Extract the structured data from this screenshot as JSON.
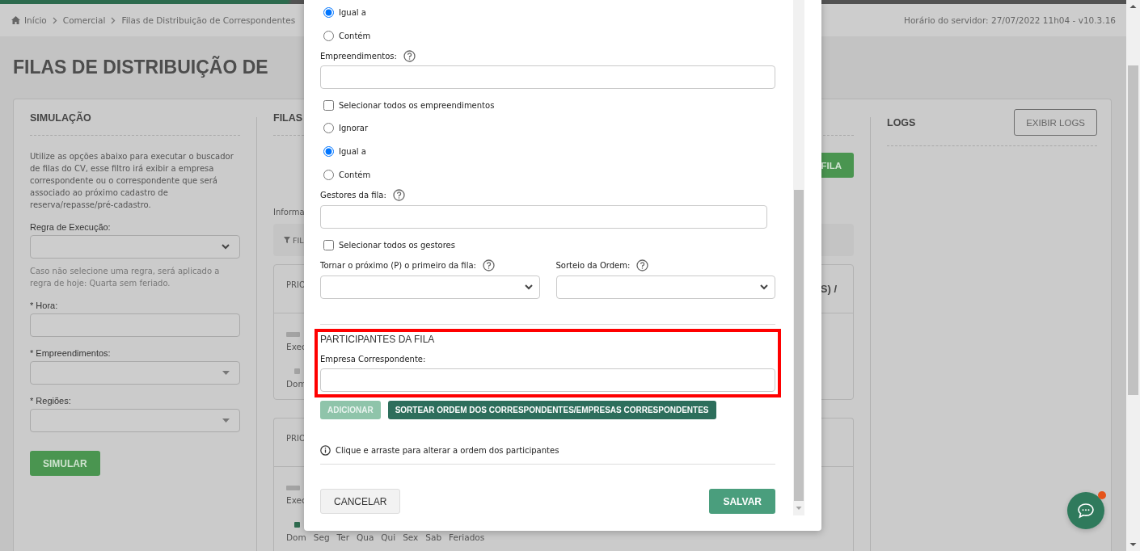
{
  "breadcrumb": [
    {
      "label": "Início",
      "kind": "home"
    },
    {
      "label": "Comercial",
      "kind": "link"
    },
    {
      "label": "Filas de Distribuição de Correspondentes",
      "kind": "link"
    }
  ],
  "server_time": "Horário do servidor: 27/07/2022 11h04 - v10.3.16",
  "page_title": "FILAS DE DISTRIBUIÇÃO DE",
  "simulation": {
    "heading": "SIMULAÇÃO",
    "description": "Utilize as opções abaixo para executar o buscador de filas do CV, esse filtro irá exibir a empresa correspondente ou o correspondente que será associado ao próximo cadastro de reserva/repasse/pré-cadastro.",
    "fields": [
      {
        "kind": "select",
        "label": "Regra de Execução:"
      },
      {
        "kind": "hint",
        "label": "Caso não selecione uma regra, será aplicado a regra de hoje: Quarta sem feriado."
      },
      {
        "kind": "input",
        "label": "* Hora:"
      },
      {
        "kind": "combo",
        "label": "* Empreendimentos:"
      },
      {
        "kind": "combo",
        "label": "* Regiões:"
      }
    ],
    "button": "SIMULAR"
  },
  "queues": {
    "heading": "FILAS",
    "new_button": "FILA",
    "info": "Informa",
    "filter_button": "FIL",
    "cards": [
      {
        "title": "PRIO",
        "title_end": "S) /",
        "exec": "Exec",
        "day_dot_on": false,
        "days": [
          "Dom"
        ]
      },
      {
        "title": "PRIO",
        "exec": "Exec",
        "day_dot_on": true,
        "days": [
          "Dom",
          "Seg",
          "Ter",
          "Qua",
          "Qui",
          "Sex",
          "Sab",
          "Feriados"
        ]
      }
    ]
  },
  "logs": {
    "heading": "LOGS",
    "button": "EXIBIR LOGS"
  },
  "modal": {
    "items": [
      {
        "kind": "radio",
        "label": "Igual a",
        "selected": true
      },
      {
        "kind": "radio",
        "label": "Contém",
        "selected": false
      },
      {
        "kind": "field",
        "label": "Empreendimentos:",
        "help": true
      },
      {
        "kind": "checkbox",
        "label": "Selecionar todos os empreendimentos",
        "checked": false
      },
      {
        "kind": "radio",
        "label": "Ignorar",
        "selected": false
      },
      {
        "kind": "radio",
        "label": "Igual a",
        "selected": true
      },
      {
        "kind": "radio",
        "label": "Contém",
        "selected": false
      },
      {
        "kind": "field",
        "label": "Gestores da fila:",
        "help": true
      },
      {
        "kind": "checkbox",
        "label": "Selecionar todos os gestores",
        "checked": false
      },
      {
        "kind": "selects",
        "fields": [
          {
            "label": "Tornar o próximo (P) o primeiro da fila:",
            "help": true
          },
          {
            "label": "Sorteio da Ordem:",
            "help": true
          }
        ]
      }
    ],
    "participants": {
      "heading": "PARTICIPANTES DA FILA",
      "highlighted": true,
      "field_label": "Empresa Correspondente:"
    },
    "actions": [
      {
        "label": "ADICIONAR",
        "disabled": true
      },
      {
        "label": "SORTEAR ORDEM DOS CORRESPONDENTES/EMPRESAS CORRESPONDENTES",
        "disabled": false
      }
    ],
    "info": "Clique e arraste para alterar a ordem dos participantes",
    "cancel": "CANCELAR",
    "save": "SALVAR"
  },
  "chat": {
    "notification": true
  }
}
